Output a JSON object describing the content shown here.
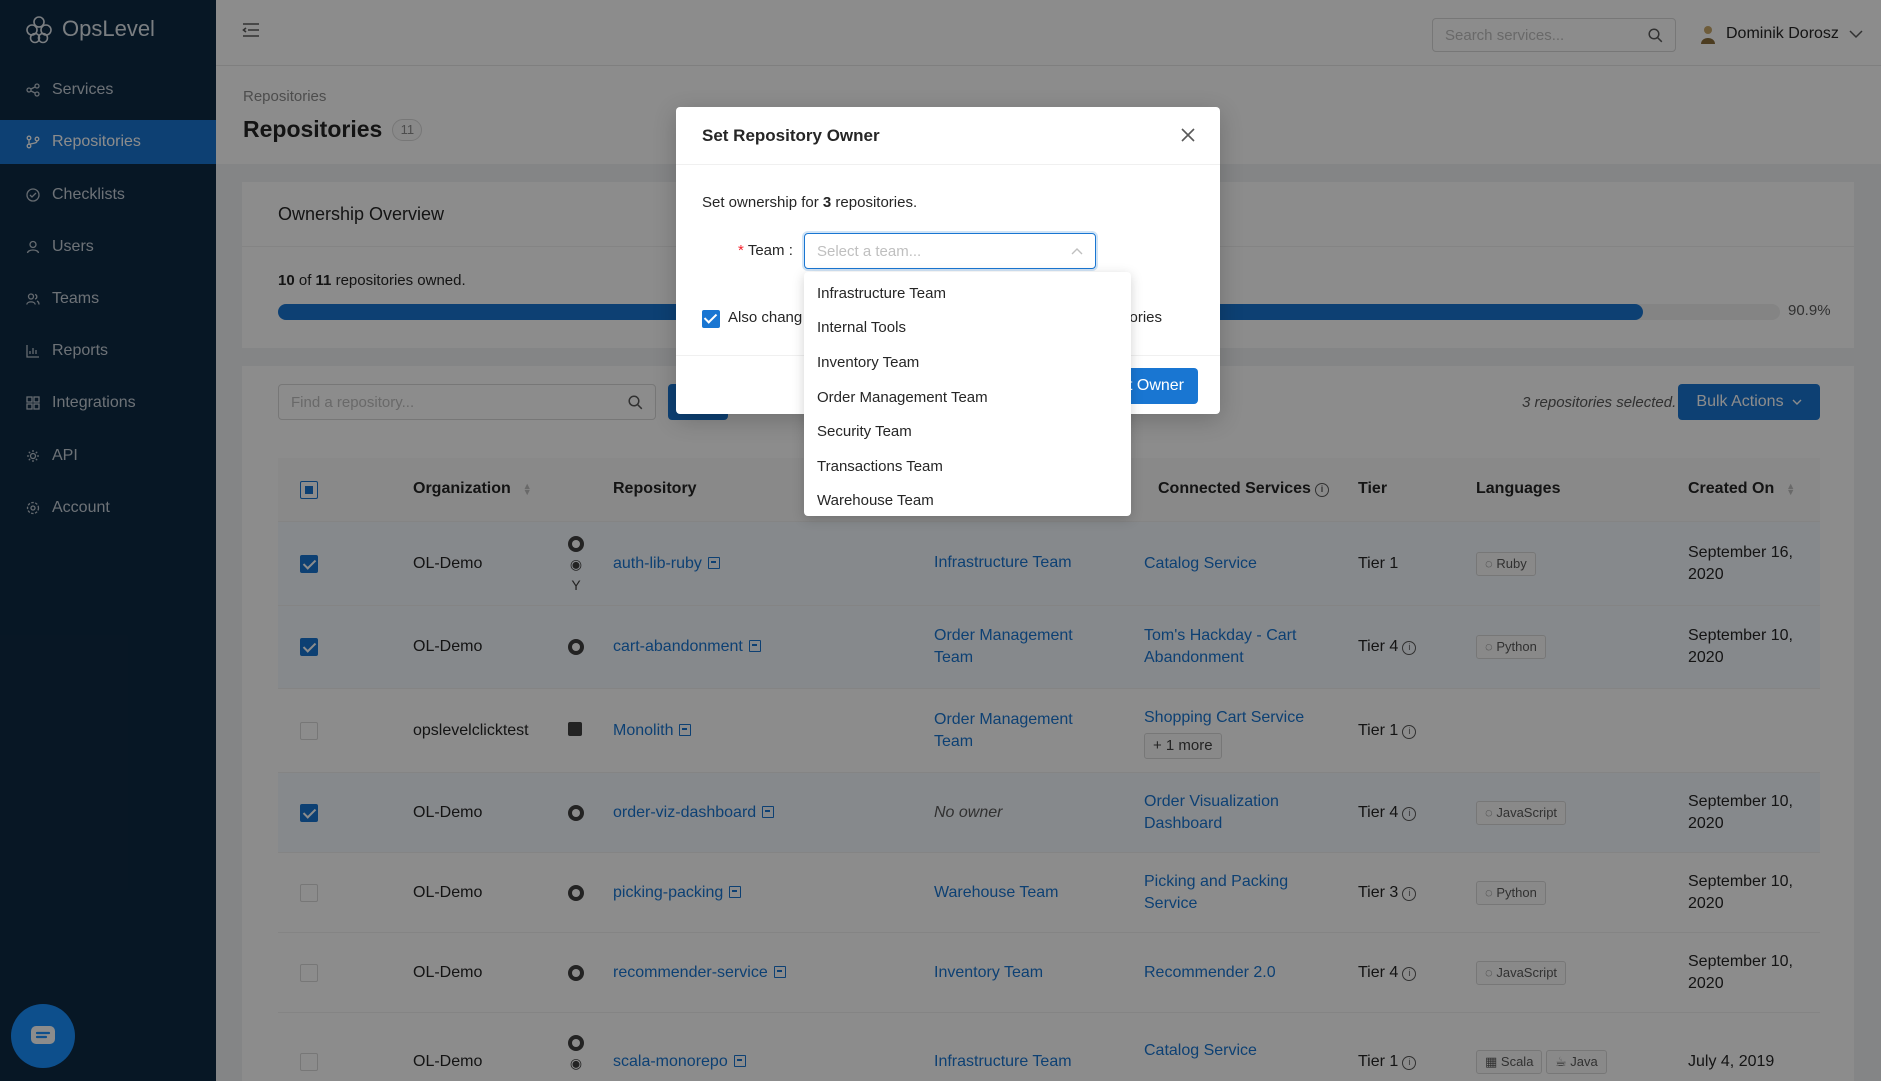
{
  "app": {
    "name": "OpsLevel",
    "search_placeholder": "Search services...",
    "user_name": "Dominik Dorosz"
  },
  "sidebar": {
    "items": [
      {
        "label": "Services",
        "icon": "share-icon",
        "active": false
      },
      {
        "label": "Repositories",
        "icon": "branch-icon",
        "active": true
      },
      {
        "label": "Checklists",
        "icon": "check-circle-icon",
        "active": false
      },
      {
        "label": "Users",
        "icon": "user-icon",
        "active": false
      },
      {
        "label": "Teams",
        "icon": "team-icon",
        "active": false
      },
      {
        "label": "Reports",
        "icon": "chart-icon",
        "active": false
      },
      {
        "label": "Integrations",
        "icon": "grid-icon",
        "active": false
      },
      {
        "label": "API",
        "icon": "api-icon",
        "active": false
      },
      {
        "label": "Account",
        "icon": "gear-icon",
        "active": false
      }
    ]
  },
  "page": {
    "breadcrumb": "Repositories",
    "title": "Repositories",
    "count": "11"
  },
  "ownership": {
    "title": "Ownership Overview",
    "owned": "10",
    "total": "11",
    "owned_suffix": "repositories owned.",
    "of_word": "of",
    "percent_text": "90.9%",
    "percent_value": 90.9
  },
  "table": {
    "search_placeholder": "Find a repository...",
    "selected_text": "3 repositories selected.",
    "bulk_actions_label": "Bulk Actions",
    "headers": {
      "organization": "Organization",
      "repository": "Repository",
      "connected_services": "Connected Services",
      "tier": "Tier",
      "languages": "Languages",
      "created_on": "Created On"
    },
    "rows": [
      {
        "selected": true,
        "org": "OL-Demo",
        "repo": "auth-lib-ruby",
        "owner": "Infrastructure Team",
        "owner_l2": "",
        "service": "Catalog Service",
        "service_l2": "",
        "tier": "Tier 1",
        "tier_info": false,
        "lang": "Ruby",
        "created": "September 16,",
        "created_l2": "2020"
      },
      {
        "selected": true,
        "org": "OL-Demo",
        "repo": "cart-abandonment",
        "owner": "Order Management",
        "owner_l2": "Team",
        "service": "Tom's Hackday - Cart",
        "service_l2": "Abandonment",
        "tier": "Tier 4",
        "tier_info": true,
        "lang": "Python",
        "created": "September 10,",
        "created_l2": "2020"
      },
      {
        "selected": false,
        "org": "opslevelclicktest",
        "repo": "Monolith",
        "owner": "Order Management",
        "owner_l2": "Team",
        "service": "Shopping Cart Service",
        "service_l2": "",
        "more": "+ 1 more",
        "tier": "Tier 1",
        "tier_info": true,
        "lang": "",
        "created": "",
        "created_l2": ""
      },
      {
        "selected": true,
        "org": "OL-Demo",
        "repo": "order-viz-dashboard",
        "owner": "No owner",
        "owner_l2": "",
        "service": "Order Visualization",
        "service_l2": "Dashboard",
        "tier": "Tier 4",
        "tier_info": true,
        "lang": "JavaScript",
        "created": "September 10,",
        "created_l2": "2020"
      },
      {
        "selected": false,
        "org": "OL-Demo",
        "repo": "picking-packing",
        "owner": "Warehouse Team",
        "owner_l2": "",
        "service": "Picking and Packing",
        "service_l2": "Service",
        "tier": "Tier 3",
        "tier_info": true,
        "lang": "Python",
        "created": "September 10,",
        "created_l2": "2020"
      },
      {
        "selected": false,
        "org": "OL-Demo",
        "repo": "recommender-service",
        "owner": "Inventory Team",
        "owner_l2": "",
        "service": "Recommender 2.0",
        "service_l2": "",
        "tier": "Tier 4",
        "tier_info": true,
        "lang": "JavaScript",
        "created": "September 10,",
        "created_l2": "2020"
      },
      {
        "selected": false,
        "org": "OL-Demo",
        "repo": "scala-monorepo",
        "owner": "Infrastructure Team",
        "owner_l2": "",
        "service": "Catalog Service",
        "service_l2": "",
        "tier": "Tier 1",
        "tier_info": true,
        "lang": "Scala",
        "lang2": "Java",
        "created": "July 4, 2019",
        "created_l2": ""
      }
    ]
  },
  "modal": {
    "title": "Set Repository Owner",
    "desc_prefix": "Set ownership for",
    "desc_count": "3",
    "desc_suffix": "repositories.",
    "team_label": "Team",
    "team_placeholder": "Select a team...",
    "checkbox_text": "Also chang",
    "checkbox_text_end": "itories",
    "submit_label": "Set Owner",
    "submit_visible": "t Owner"
  },
  "dropdown": {
    "options": [
      "Infrastructure Team",
      "Internal Tools",
      "Inventory Team",
      "Order Management Team",
      "Security Team",
      "Transactions Team",
      "Warehouse Team"
    ]
  },
  "colors": {
    "sidebar_bg": "#0e2a44",
    "accent": "#1976d2",
    "required": "#f5222d"
  }
}
